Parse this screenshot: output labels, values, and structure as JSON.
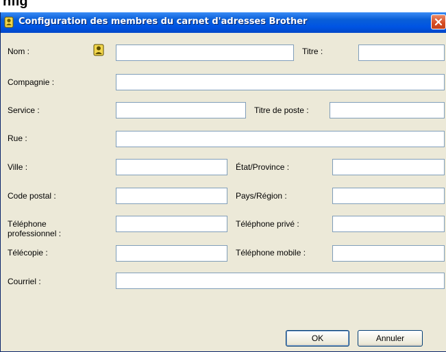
{
  "window": {
    "partial_heading": "nfig",
    "title": "Configuration des membres du carnet d'adresses Brother",
    "close_icon": "close-icon",
    "title_icon": "address-book-icon"
  },
  "form": {
    "nom": {
      "label": "Nom :",
      "value": ""
    },
    "titre": {
      "label": "Titre :",
      "value": ""
    },
    "compagnie": {
      "label": "Compagnie :",
      "value": ""
    },
    "service": {
      "label": "Service :",
      "value": ""
    },
    "titre_poste": {
      "label": "Titre de poste :",
      "value": ""
    },
    "rue": {
      "label": "Rue :",
      "value": ""
    },
    "ville": {
      "label": "Ville :",
      "value": ""
    },
    "etat": {
      "label": "État/Province :",
      "value": ""
    },
    "code_postal": {
      "label": "Code postal :",
      "value": ""
    },
    "pays": {
      "label": "Pays/Région :",
      "value": ""
    },
    "tel_pro": {
      "label": "Téléphone\nprofessionnel :",
      "value": ""
    },
    "tel_prive": {
      "label": "Téléphone privé :",
      "value": ""
    },
    "telecopie": {
      "label": "Télécopie :",
      "value": ""
    },
    "tel_mobile": {
      "label": "Téléphone mobile :",
      "value": ""
    },
    "courriel": {
      "label": "Courriel :",
      "value": ""
    }
  },
  "buttons": {
    "ok": "OK",
    "annuler": "Annuler"
  },
  "colors": {
    "titlebar": "#0054e3",
    "dialog_bg": "#ece9d8",
    "field_border": "#7f9db9"
  }
}
